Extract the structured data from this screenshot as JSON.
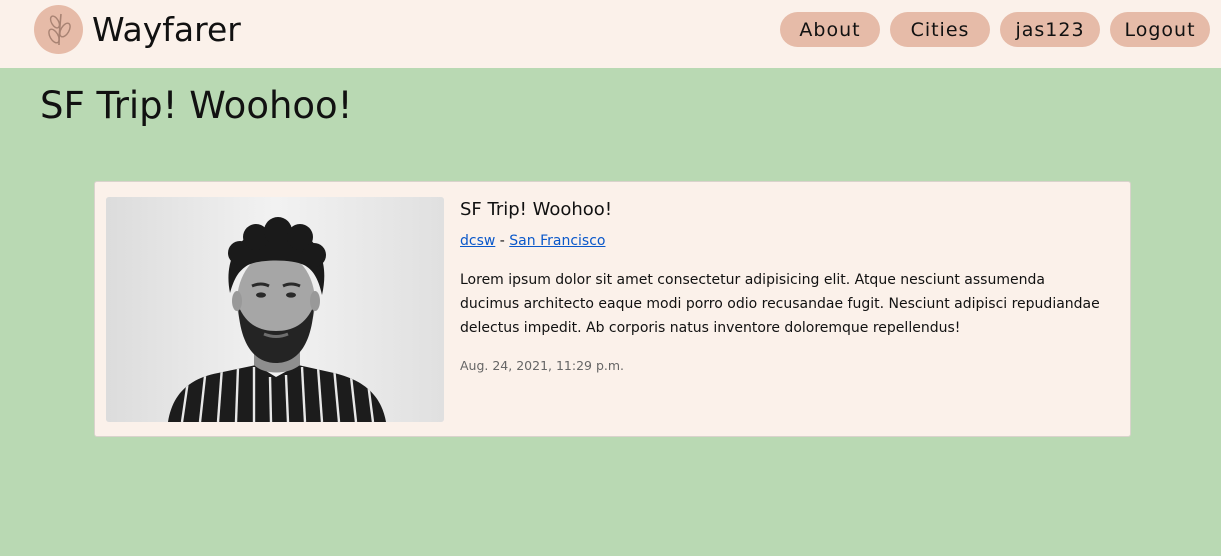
{
  "brand": {
    "name": "Wayfarer",
    "logo_icon": "leaf-branch-icon"
  },
  "nav": {
    "items": [
      {
        "label": "About"
      },
      {
        "label": "Cities"
      },
      {
        "label": "jas123"
      },
      {
        "label": "Logout"
      }
    ]
  },
  "page": {
    "title": "SF Trip! Woohoo!"
  },
  "post": {
    "title": "SF Trip! Woohoo!",
    "author": "dcsw",
    "separator": " - ",
    "city": "San Francisco",
    "body": "Lorem ipsum dolor sit amet consectetur adipisicing elit. Atque nesciunt assumenda ducimus architecto eaque modi porro odio recusandae fugit. Nesciunt adipisci repudiandae delectus impedit. Ab corporis natus inventore doloremque repellendus!",
    "timestamp": "Aug. 24, 2021, 11:29 p.m."
  },
  "colors": {
    "page_background": "#b9d9b3",
    "navbar_background": "#fbf1ea",
    "nav_button": "#e6bba8",
    "link": "#0a58ca"
  }
}
